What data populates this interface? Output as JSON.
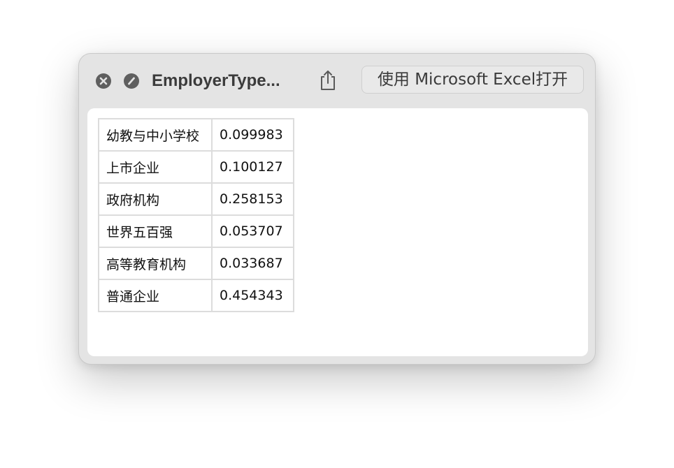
{
  "window": {
    "title": "EmployerType...",
    "open_button_label": "使用 Microsoft Excel打开"
  },
  "icons": {
    "close": "close-x-icon",
    "fullscreen": "no-entry-slash-icon",
    "share": "share-icon"
  },
  "table": {
    "rows": [
      {
        "label": "幼教与中小学校",
        "value": "0.099983"
      },
      {
        "label": "上市企业",
        "value": "0.100127"
      },
      {
        "label": "政府机构",
        "value": "0.258153"
      },
      {
        "label": "世界五百强",
        "value": "0.053707"
      },
      {
        "label": "高等教育机构",
        "value": "0.033687"
      },
      {
        "label": "普通企业",
        "value": "0.454343"
      }
    ]
  }
}
